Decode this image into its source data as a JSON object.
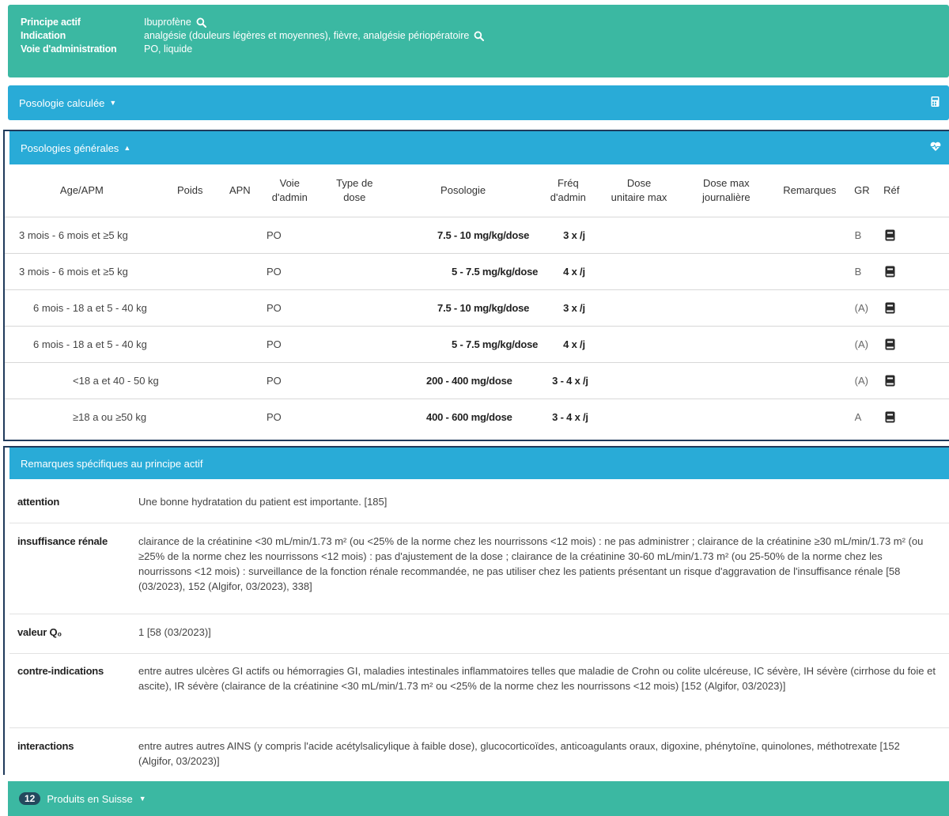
{
  "header": {
    "rows": [
      {
        "label": "Principe actif",
        "value": "Ibuprofène",
        "search": true
      },
      {
        "label": "Indication",
        "value": "analgésie (douleurs légères et moyennes), fièvre, analgésie périopératoire",
        "search": true
      },
      {
        "label": "Voie d'administration",
        "value": "PO, liquide",
        "search": false
      }
    ]
  },
  "calc_panel": {
    "label": "Posologie calculée",
    "icon": "calculator-icon"
  },
  "general_panel": {
    "label": "Posologies générales",
    "icon": "heart-icon"
  },
  "table": {
    "headers": {
      "age": "Age/APM",
      "poids": "Poids",
      "apn": "APN",
      "voie": [
        "Voie",
        "d'admin"
      ],
      "type": [
        "Type de",
        "dose"
      ],
      "posologie": "Posologie",
      "freq": [
        "Fréq",
        "d'admin"
      ],
      "dose_unit": [
        "Dose",
        "unitaire max"
      ],
      "dose_day": [
        "Dose max",
        "journalière"
      ],
      "remarques": "Remarques",
      "gr": "GR",
      "ref": "Réf"
    },
    "rows": [
      {
        "age": "3 mois - 6 mois et ≥5 kg",
        "voie": "PO",
        "posologie": "7.5 - 10 mg/kg/dose",
        "freq": "3 x /j",
        "gr": "B"
      },
      {
        "age": "3 mois - 6 mois et ≥5 kg",
        "voie": "PO",
        "posologie": "5 - 7.5 mg/kg/dose",
        "freq": "4 x /j",
        "gr": "B"
      },
      {
        "age": "6 mois - 18 a et 5 - 40 kg",
        "voie": "PO",
        "posologie": "7.5 - 10 mg/kg/dose",
        "freq": "3 x /j",
        "gr": "(A)"
      },
      {
        "age": "6 mois - 18 a et 5 - 40 kg",
        "voie": "PO",
        "posologie": "5 - 7.5 mg/kg/dose",
        "freq": "4 x /j",
        "gr": "(A)"
      },
      {
        "age": "<18 a et 40 - 50 kg",
        "voie": "PO",
        "posologie": "200 - 400 mg/dose",
        "freq": "3 - 4 x /j",
        "gr": "(A)"
      },
      {
        "age": "≥18 a ou ≥50 kg",
        "voie": "PO",
        "posologie": "400 - 600 mg/dose",
        "freq": "3 - 4 x /j",
        "gr": "A"
      }
    ]
  },
  "remarks": {
    "title": "Remarques spécifiques au principe actif",
    "items": [
      {
        "key": "attention",
        "value": "Une bonne hydratation du patient est importante. [185]"
      },
      {
        "key": "insuffisance rénale",
        "value": "clairance de la créatinine <30 mL/min/1.73 m² (ou <25% de la norme chez les nourrissons <12 mois) : ne pas administrer ; clairance de la créatinine ≥30 mL/min/1.73 m² (ou ≥25% de la norme chez les nourrissons <12 mois) : pas d'ajustement de la dose ; clairance de la créatinine 30-60 mL/min/1.73 m² (ou 25-50% de la norme chez les nourrissons <12 mois) : surveillance de la fonction rénale recommandée, ne pas utiliser chez les patients présentant un risque d'aggravation de l'insuffisance rénale [58 (03/2023), 152 (Algifor, 03/2023), 338]"
      },
      {
        "key": "valeur Q₀",
        "value": "1 [58 (03/2023)]"
      },
      {
        "key": "contre-indications",
        "value": "entre autres ulcères GI actifs ou hémorragies GI, maladies intestinales inflammatoires telles que maladie de Crohn ou colite ulcéreuse, IC sévère, IH sévère (cirrhose du foie et ascite), IR sévère (clairance de la créatinine <30 mL/min/1.73 m² ou <25% de la norme chez les nourrissons <12 mois) [152 (Algifor, 03/2023)]"
      },
      {
        "key": "interactions",
        "value": "entre autres autres AINS (y compris l'acide acétylsalicylique à faible dose), glucocorticoïdes, anticoagulants oraux, digoxine, phénytoïne, quinolones, méthotrexate [152 (Algifor, 03/2023)]"
      }
    ]
  },
  "footer": {
    "count": "12",
    "label": "Produits en Suisse"
  },
  "colors": {
    "teal": "#3bb8a2",
    "blue": "#29abd7",
    "navy": "#203a5b",
    "badge": "#23495e"
  }
}
